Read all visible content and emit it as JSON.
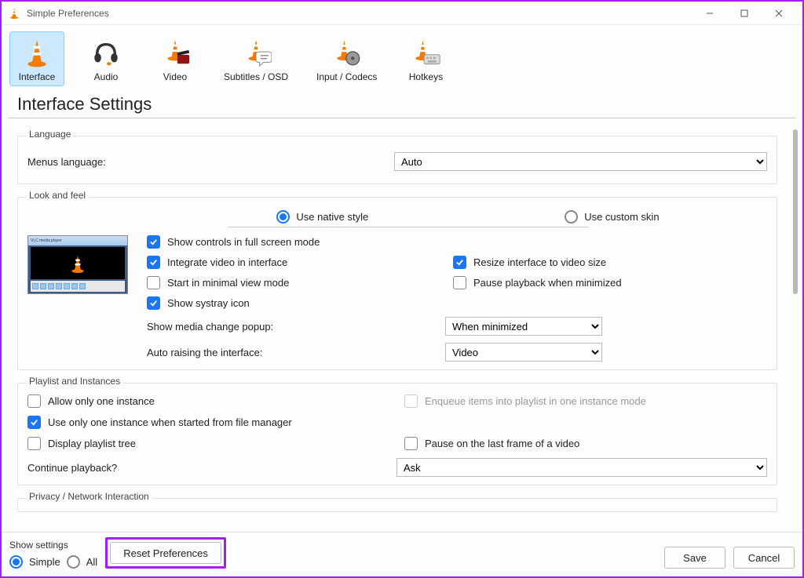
{
  "window": {
    "title": "Simple Preferences"
  },
  "toolbar": {
    "items": [
      {
        "label": "Interface",
        "selected": true
      },
      {
        "label": "Audio"
      },
      {
        "label": "Video"
      },
      {
        "label": "Subtitles / OSD"
      },
      {
        "label": "Input / Codecs"
      },
      {
        "label": "Hotkeys"
      }
    ]
  },
  "page": {
    "heading": "Interface Settings"
  },
  "language_group": {
    "legend": "Language",
    "menus_label": "Menus language:",
    "menus_value": "Auto"
  },
  "look_group": {
    "legend": "Look and feel",
    "native_label": "Use native style",
    "custom_label": "Use custom skin",
    "checks": {
      "fullscreen_controls": "Show controls in full screen mode",
      "integrate_video": "Integrate video in interface",
      "start_minimal": "Start in minimal view mode",
      "show_systray": "Show systray icon",
      "resize_interface": "Resize interface to video size",
      "pause_minimized": "Pause playback when minimized"
    },
    "popup_label": "Show media change popup:",
    "popup_value": "When minimized",
    "autoraise_label": "Auto raising the interface:",
    "autoraise_value": "Video"
  },
  "playlist_group": {
    "legend": "Playlist and Instances",
    "allow_one": "Allow only one instance",
    "enqueue": "Enqueue items into playlist in one instance mode",
    "one_file_manager": "Use only one instance when started from file manager",
    "display_tree": "Display playlist tree",
    "pause_last_frame": "Pause on the last frame of a video",
    "continue_label": "Continue playback?",
    "continue_value": "Ask"
  },
  "privacy_group": {
    "legend": "Privacy / Network Interaction"
  },
  "footer": {
    "show_settings_label": "Show settings",
    "simple": "Simple",
    "all": "All",
    "reset": "Reset Preferences",
    "save": "Save",
    "cancel": "Cancel"
  }
}
